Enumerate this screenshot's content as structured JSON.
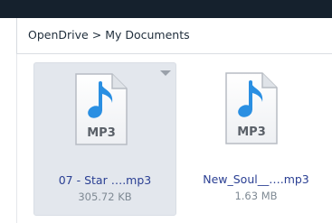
{
  "breadcrumb": {
    "root": "OpenDrive",
    "separator": ">",
    "current": "My Documents"
  },
  "files": [
    {
      "name": "07 - Star ….mp3",
      "size": "305.72 KB",
      "badge": "MP3",
      "icon": "mp3-file-icon",
      "selected": true
    },
    {
      "name": "New_Soul__….mp3",
      "size": "1.63 MB",
      "badge": "MP3",
      "icon": "mp3-file-icon",
      "selected": false
    }
  ],
  "colors": {
    "topbar": "#15212d",
    "selected_tile": "#e3e7ed",
    "file_name": "#2a3f93",
    "file_size": "#7f8a94",
    "music_note": "#2a8fe2"
  }
}
